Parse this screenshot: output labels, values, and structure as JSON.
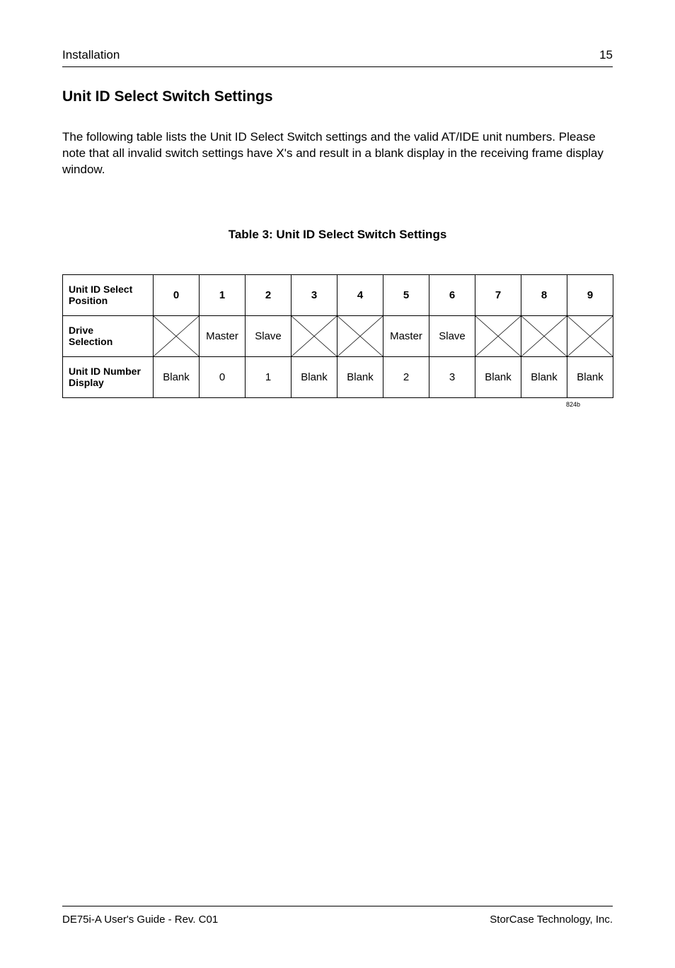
{
  "header": {
    "left": "Installation",
    "right": "15"
  },
  "title": "Unit ID Select Switch Settings",
  "intro": "The following table lists the Unit ID Select Switch settings and the valid AT/IDE unit numbers. Please note that all invalid switch settings have X's and result in a blank display in the receiving frame  display  window.",
  "table_caption": "Table 3:  Unit ID Select Switch Settings",
  "table": {
    "row_headers": {
      "r1a": "Unit ID Select",
      "r1b": "Position",
      "r2a": "Drive",
      "r2b": "Selection",
      "r3a": "Unit ID Number",
      "r3b": "Display"
    },
    "cols": [
      "0",
      "1",
      "2",
      "3",
      "4",
      "5",
      "6",
      "7",
      "8",
      "9"
    ],
    "drive_row": {
      "0": "X",
      "1": "Master",
      "2": "Slave",
      "3": "X",
      "4": "X",
      "5": "Master",
      "6": "Slave",
      "7": "X",
      "8": "X",
      "9": "X"
    },
    "display_row": {
      "0": "Blank",
      "1": "0",
      "2": "1",
      "3": "Blank",
      "4": "Blank",
      "5": "2",
      "6": "3",
      "7": "Blank",
      "8": "Blank",
      "9": "Blank"
    }
  },
  "figno": "824b",
  "footer": {
    "left": "DE75i-A User's Guide - Rev. C01",
    "right": "StorCase Technology, Inc."
  },
  "chart_data": {
    "type": "table",
    "title": "Unit ID Select Switch Settings",
    "columns": [
      "Unit ID Select Position",
      "Drive Selection",
      "Unit ID Number Display"
    ],
    "rows": [
      {
        "Unit ID Select Position": 0,
        "Drive Selection": "Invalid",
        "Unit ID Number Display": "Blank"
      },
      {
        "Unit ID Select Position": 1,
        "Drive Selection": "Master",
        "Unit ID Number Display": "0"
      },
      {
        "Unit ID Select Position": 2,
        "Drive Selection": "Slave",
        "Unit ID Number Display": "1"
      },
      {
        "Unit ID Select Position": 3,
        "Drive Selection": "Invalid",
        "Unit ID Number Display": "Blank"
      },
      {
        "Unit ID Select Position": 4,
        "Drive Selection": "Invalid",
        "Unit ID Number Display": "Blank"
      },
      {
        "Unit ID Select Position": 5,
        "Drive Selection": "Master",
        "Unit ID Number Display": "2"
      },
      {
        "Unit ID Select Position": 6,
        "Drive Selection": "Slave",
        "Unit ID Number Display": "3"
      },
      {
        "Unit ID Select Position": 7,
        "Drive Selection": "Invalid",
        "Unit ID Number Display": "Blank"
      },
      {
        "Unit ID Select Position": 8,
        "Drive Selection": "Invalid",
        "Unit ID Number Display": "Blank"
      },
      {
        "Unit ID Select Position": 9,
        "Drive Selection": "Invalid",
        "Unit ID Number Display": "Blank"
      }
    ]
  }
}
